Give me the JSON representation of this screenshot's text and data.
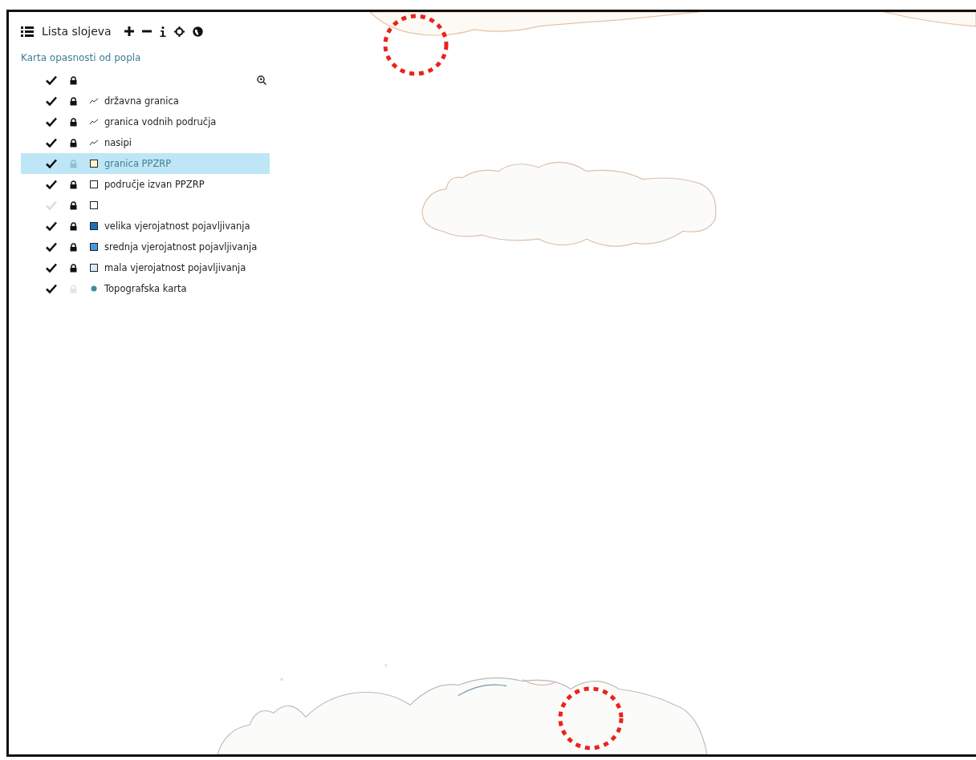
{
  "toolbar": {
    "title": "Lista slojeva"
  },
  "group": {
    "title": "Karta opasnosti od popla",
    "checked": true,
    "locked": true
  },
  "layers": [
    {
      "label": "državna granica",
      "kind": "line",
      "checked": true,
      "locked": true,
      "selected": false
    },
    {
      "label": "granica vodnih područja",
      "kind": "line",
      "checked": true,
      "locked": true,
      "selected": false
    },
    {
      "label": "nasipi",
      "kind": "line",
      "checked": true,
      "locked": true,
      "selected": false
    },
    {
      "label": "granica PPZRP",
      "kind": "box",
      "color": "#fff4cc",
      "checked": true,
      "locked": false,
      "selected": true
    },
    {
      "label": "područje izvan PPZRP",
      "kind": "box",
      "color": "#ffffff",
      "checked": true,
      "locked": true,
      "selected": false
    },
    {
      "kind": "box",
      "color": "#ffffff",
      "checked": false,
      "locked": true,
      "selected": false
    },
    {
      "label": "velika vjerojatnost pojavljivanja",
      "kind": "box",
      "color": "#1f6fb8",
      "checked": true,
      "locked": true,
      "selected": false
    },
    {
      "label": "srednja vjerojatnost pojavljivanja",
      "kind": "box",
      "color": "#4a97dc",
      "checked": true,
      "locked": true,
      "selected": false
    },
    {
      "label": "mala vjerojatnost pojavljivanja",
      "kind": "box",
      "color": "#d4ecf7",
      "checked": true,
      "locked": true,
      "selected": false
    },
    {
      "label": "Topografska karta",
      "kind": "dot",
      "color": "#3f8d99",
      "checked": true,
      "locked": false,
      "selected": false
    }
  ]
}
